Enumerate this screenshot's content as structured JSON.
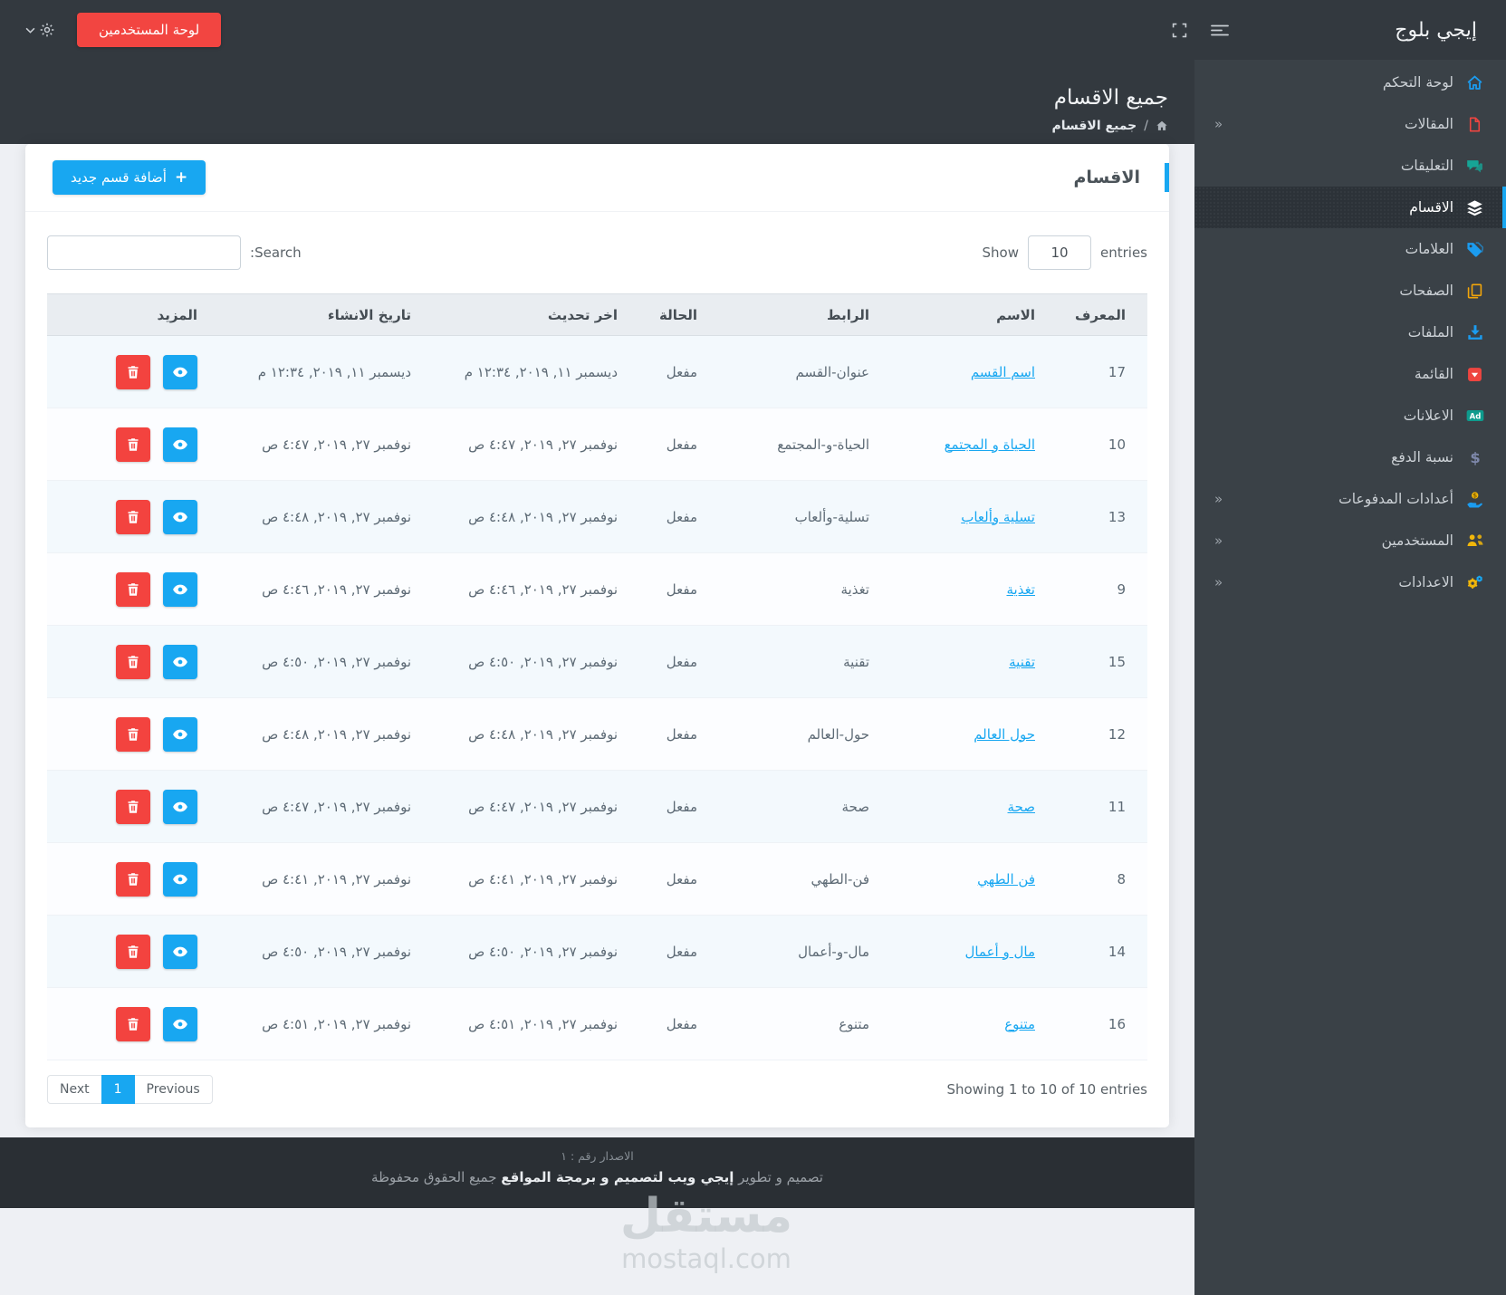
{
  "brand": "إيجي بلوج",
  "navbar": {
    "users_button": "لوحة المستخدمين"
  },
  "page": {
    "title": "جميع الاقسام",
    "breadcrumb_sep": "/",
    "breadcrumb_current": "جميع الاقسام"
  },
  "sidebar": {
    "items": [
      {
        "key": "home",
        "label": "لوحة التحكم",
        "color": "#1b9cf0",
        "expand": false,
        "active": false
      },
      {
        "key": "file",
        "label": "المقالات",
        "color": "#ee4540",
        "expand": true,
        "active": false
      },
      {
        "key": "comments",
        "label": "التعليقات",
        "color": "#16a596",
        "expand": false,
        "active": false
      },
      {
        "key": "layers",
        "label": "الاقسام",
        "color": "#ffffff",
        "expand": false,
        "active": true
      },
      {
        "key": "tags",
        "label": "العلامات",
        "color": "#1b9cf0",
        "expand": false,
        "active": false
      },
      {
        "key": "pages",
        "label": "الصفحات",
        "color": "#f2a50a",
        "expand": false,
        "active": false
      },
      {
        "key": "download",
        "label": "الملفات",
        "color": "#1b9cf0",
        "expand": false,
        "active": false
      },
      {
        "key": "caret-square",
        "label": "القائمة",
        "color": "#ee4540",
        "expand": false,
        "active": false
      },
      {
        "key": "ad",
        "label": "الاعلانات",
        "color": "#0e9b8d",
        "expand": false,
        "active": false
      },
      {
        "key": "dollar",
        "label": "نسبة الدفع",
        "color": "#7e88ab",
        "expand": false,
        "active": false
      },
      {
        "key": "hand-usd",
        "label": "أعدادات المدفوعات",
        "color": "#1b9cf0",
        "expand": true,
        "active": false
      },
      {
        "key": "users",
        "label": "المستخدمين",
        "color": "#f2b70a",
        "expand": true,
        "active": false
      },
      {
        "key": "cogs",
        "label": "الاعدادات",
        "color": "#f2b70a",
        "expand": true,
        "active": false
      }
    ]
  },
  "card": {
    "title": "الاقسام",
    "add_button": "أضافة قسم جديد",
    "length": {
      "show": "Show",
      "value": "10",
      "entries": "entries"
    },
    "search_label": "Search:",
    "table": {
      "headers": [
        "المعرف",
        "الاسم",
        "الرابط",
        "الحالة",
        "اخر تحديث",
        "تاريخ الانشاء",
        "المزيد"
      ],
      "rows": [
        {
          "id": "17",
          "name": "اسم القسم",
          "slug": "عنوان-القسم",
          "status": "مفعل",
          "updated": "ديسمبر ١١, ٢٠١٩, ١٢:٣٤ م",
          "created": "ديسمبر ١١, ٢٠١٩, ١٢:٣٤ م"
        },
        {
          "id": "10",
          "name": "الحياة و المجتمع",
          "slug": "الحياة-و-المجتمع",
          "status": "مفعل",
          "updated": "نوفمبر ٢٧, ٢٠١٩, ٤:٤٧ ص",
          "created": "نوفمبر ٢٧, ٢٠١٩, ٤:٤٧ ص"
        },
        {
          "id": "13",
          "name": "تسلية وألعاب",
          "slug": "تسلية-وألعاب",
          "status": "مفعل",
          "updated": "نوفمبر ٢٧, ٢٠١٩, ٤:٤٨ ص",
          "created": "نوفمبر ٢٧, ٢٠١٩, ٤:٤٨ ص"
        },
        {
          "id": "9",
          "name": "تغذية",
          "slug": "تغذية",
          "status": "مفعل",
          "updated": "نوفمبر ٢٧, ٢٠١٩, ٤:٤٦ ص",
          "created": "نوفمبر ٢٧, ٢٠١٩, ٤:٤٦ ص"
        },
        {
          "id": "15",
          "name": "تقنية",
          "slug": "تقنية",
          "status": "مفعل",
          "updated": "نوفمبر ٢٧, ٢٠١٩, ٤:٥٠ ص",
          "created": "نوفمبر ٢٧, ٢٠١٩, ٤:٥٠ ص"
        },
        {
          "id": "12",
          "name": "حول العالم",
          "slug": "حول-العالم",
          "status": "مفعل",
          "updated": "نوفمبر ٢٧, ٢٠١٩, ٤:٤٨ ص",
          "created": "نوفمبر ٢٧, ٢٠١٩, ٤:٤٨ ص"
        },
        {
          "id": "11",
          "name": "صحة",
          "slug": "صحة",
          "status": "مفعل",
          "updated": "نوفمبر ٢٧, ٢٠١٩, ٤:٤٧ ص",
          "created": "نوفمبر ٢٧, ٢٠١٩, ٤:٤٧ ص"
        },
        {
          "id": "8",
          "name": "فن الطهي",
          "slug": "فن-الطهي",
          "status": "مفعل",
          "updated": "نوفمبر ٢٧, ٢٠١٩, ٤:٤١ ص",
          "created": "نوفمبر ٢٧, ٢٠١٩, ٤:٤١ ص"
        },
        {
          "id": "14",
          "name": "مال و أعمال",
          "slug": "مال-و-أعمال",
          "status": "مفعل",
          "updated": "نوفمبر ٢٧, ٢٠١٩, ٤:٥٠ ص",
          "created": "نوفمبر ٢٧, ٢٠١٩, ٤:٥٠ ص"
        },
        {
          "id": "16",
          "name": "متنوع",
          "slug": "متنوع",
          "status": "مفعل",
          "updated": "نوفمبر ٢٧, ٢٠١٩, ٤:٥١ ص",
          "created": "نوفمبر ٢٧, ٢٠١٩, ٤:٥١ ص"
        }
      ]
    },
    "info": "Showing 1 to 10 of 10 entries",
    "pagination": [
      {
        "label": "Next",
        "active": false
      },
      {
        "label": "1",
        "active": true
      },
      {
        "label": "Previous",
        "active": false
      }
    ]
  },
  "watermark": {
    "line1": "مستقل",
    "line2": "mostaql.com"
  },
  "footer": {
    "version": "الاصدار رقم : ١",
    "credit_prefix": "تصميم و تطوير ",
    "credit_brand": "إيجي ويب لتصميم و برمجة المواقع",
    "credit_suffix": " جميع الحقوق محفوظة"
  },
  "colors": {
    "accent": "#18a7f1",
    "danger": "#f24541",
    "sidebar": "#3a4147"
  }
}
